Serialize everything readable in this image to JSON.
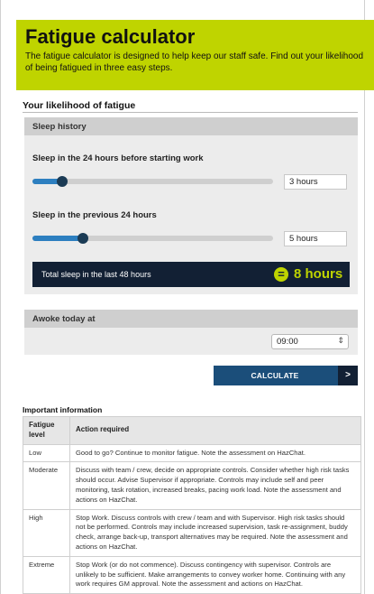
{
  "header": {
    "title": "Fatigue calculator",
    "description": "The fatigue calculator is designed to help keep our staff safe. Find out your likelihood of being fatigued in three easy steps."
  },
  "likelihood": {
    "title": "Your likelihood of fatigue"
  },
  "sleep_history": {
    "heading": "Sleep history",
    "field1": {
      "label": "Sleep in the 24 hours before starting work",
      "value": "3 hours",
      "level": 3,
      "max": 24
    },
    "field2": {
      "label": "Sleep in the previous 24 hours",
      "value": "5 hours",
      "level": 5,
      "max": 24
    },
    "total_label": "Total sleep in the last 48 hours",
    "total_icon": "=",
    "total_value": "8 hours"
  },
  "awoke": {
    "heading": "Awoke today at",
    "selected": "09:00"
  },
  "calculate": {
    "label": "CALCULATE",
    "chevron": ">"
  },
  "info": {
    "title": "Important information",
    "headers": [
      "Fatigue level",
      "Action required"
    ],
    "rows": [
      {
        "level": "Low",
        "action": "Good to go? Continue to monitor fatigue. Note the assessment on HazChat."
      },
      {
        "level": "Moderate",
        "action": "Discuss with team / crew, decide on appropriate controls. Consider whether high risk tasks should occur. Advise Supervisor if appropriate. Controls may include self and peer monitoring, task rotation, increased breaks, pacing work load. Note the assessment and actions on HazChat."
      },
      {
        "level": "High",
        "action": "Stop Work. Discuss controls with crew / team and with Supervisor. High risk tasks should not be performed. Controls may include increased supervision, task re-assignment, buddy check, arrange back-up, transport alternatives may be required. Note the assessment and actions on HazChat."
      },
      {
        "level": "Extreme",
        "action": "Stop Work (or do not commence). Discuss contingency with supervisor. Controls are unlikely to be sufficient. Make arrangements to convey worker home. Continuing with any work requires GM approval. Note the assessment and actions on HazChat."
      }
    ]
  },
  "colors": {
    "accent": "#bfd400",
    "navy": "#122034",
    "button": "#1b4e7a",
    "slider": "#2d7fc0"
  }
}
